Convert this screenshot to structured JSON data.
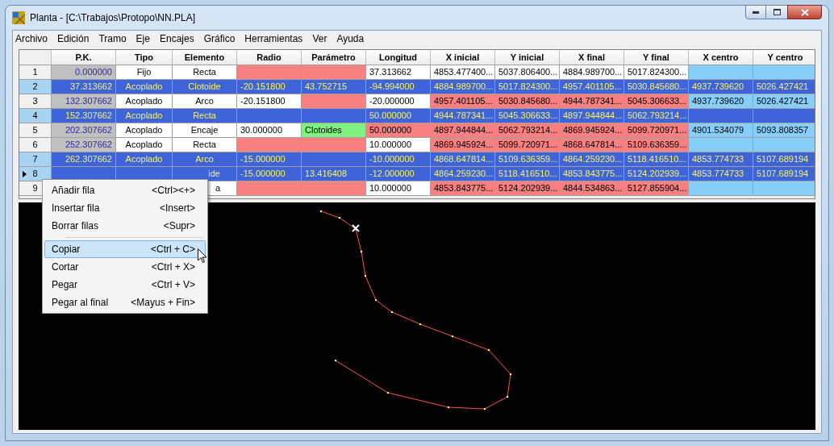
{
  "window": {
    "title": "Planta - [C:\\Trabajos\\Protopo\\NN.PLA]"
  },
  "menu_bar": [
    "Archivo",
    "Edición",
    "Tramo",
    "Eje",
    "Encajes",
    "Gráfico",
    "Herramientas",
    "Ver",
    "Ayuda"
  ],
  "table": {
    "columns": [
      "P.K.",
      "Tipo",
      "Elemento",
      "Radio",
      "Parámetro",
      "Longitud",
      "X inicial",
      "Y inicial",
      "X final",
      "Y final",
      "X centro",
      "Y centro"
    ],
    "rows": [
      {
        "number": "1",
        "selected": false,
        "current": false,
        "cells": [
          {
            "text": "0.000000",
            "color": "#c0c0c0"
          },
          {
            "text": "Fijo",
            "color": "#ffffff"
          },
          {
            "text": "Recta",
            "color": "#ffffff"
          },
          {
            "color": "#f88080"
          },
          {
            "color": "#f88080"
          },
          {
            "text": "37.313662",
            "color": "#ffffff"
          },
          {
            "text": "4853.477400...",
            "color": "#ffffff"
          },
          {
            "text": "5037.806400...",
            "color": "#ffffff"
          },
          {
            "text": "4884.989700...",
            "color": "#ffffff"
          },
          {
            "text": "5017.824300...",
            "color": "#ffffff"
          },
          {
            "color": "#87cefa"
          },
          {
            "color": "#87cefa"
          }
        ]
      },
      {
        "number": "2",
        "selected": true,
        "current": false,
        "cells": [
          {
            "text": "37.313662"
          },
          {
            "text": "Acoplado"
          },
          {
            "text": "Clotoide"
          },
          {
            "text": "-20.151800"
          },
          {
            "text": "43.752715"
          },
          {
            "text": "-94.994000"
          },
          {
            "text": "4884.989700..."
          },
          {
            "text": "5017.824300..."
          },
          {
            "text": "4957.401105..."
          },
          {
            "text": "5030.845680..."
          },
          {
            "text": "4937.739620"
          },
          {
            "text": "5026.427421"
          }
        ]
      },
      {
        "number": "3",
        "selected": false,
        "current": false,
        "cells": [
          {
            "text": "132.307662",
            "color": "#c0c0c0"
          },
          {
            "text": "Acoplado",
            "color": "#ffffff"
          },
          {
            "text": "Arco",
            "color": "#ffffff"
          },
          {
            "text": "-20.151800",
            "color": "#ffffff"
          },
          {
            "color": "#f88080"
          },
          {
            "text": "-20.000000",
            "color": "#ffffff"
          },
          {
            "text": "4957.401105...",
            "color": "#f88080"
          },
          {
            "text": "5030.845680...",
            "color": "#f88080"
          },
          {
            "text": "4944.787341...",
            "color": "#f88080"
          },
          {
            "text": "5045.306633...",
            "color": "#f88080"
          },
          {
            "text": "4937.739620",
            "color": "#87cefa"
          },
          {
            "text": "5026.427421",
            "color": "#87cefa"
          }
        ]
      },
      {
        "number": "4",
        "selected": true,
        "current": false,
        "cells": [
          {
            "text": "152.307662"
          },
          {
            "text": "Acoplado"
          },
          {
            "text": "Recta"
          },
          {},
          {},
          {
            "text": "50.000000"
          },
          {
            "text": "4944.787341..."
          },
          {
            "text": "5045.306633..."
          },
          {
            "text": "4897.944844..."
          },
          {
            "text": "5062.793214..."
          },
          {},
          {}
        ]
      },
      {
        "number": "5",
        "selected": false,
        "current": false,
        "cells": [
          {
            "text": "202.307662",
            "color": "#c0c0c0"
          },
          {
            "text": "Acoplado",
            "color": "#ffffff"
          },
          {
            "text": "Encaje",
            "color": "#ffffff"
          },
          {
            "text": "30.000000",
            "color": "#ffffff"
          },
          {
            "text": "Clotoides",
            "color": "#80f080"
          },
          {
            "text": "50.000000",
            "color": "#f88080"
          },
          {
            "text": "4897.944844...",
            "color": "#f88080"
          },
          {
            "text": "5062.793214...",
            "color": "#f88080"
          },
          {
            "text": "4869.945924...",
            "color": "#f88080"
          },
          {
            "text": "5099.720971...",
            "color": "#f88080"
          },
          {
            "text": "4901.534079",
            "color": "#87cefa"
          },
          {
            "text": "5093.808357",
            "color": "#87cefa"
          }
        ]
      },
      {
        "number": "6",
        "selected": false,
        "current": false,
        "cells": [
          {
            "text": "252.307662",
            "color": "#c0c0c0"
          },
          {
            "text": "Acoplado",
            "color": "#ffffff"
          },
          {
            "text": "Recta",
            "color": "#ffffff"
          },
          {
            "color": "#f88080"
          },
          {
            "color": "#f88080"
          },
          {
            "text": "10.000000",
            "color": "#ffffff"
          },
          {
            "text": "4869.945924...",
            "color": "#f88080"
          },
          {
            "text": "5099.720971...",
            "color": "#f88080"
          },
          {
            "text": "4868.647814...",
            "color": "#f88080"
          },
          {
            "text": "5109.636359...",
            "color": "#f88080"
          },
          {
            "color": "#87cefa"
          },
          {
            "color": "#87cefa"
          }
        ]
      },
      {
        "number": "7",
        "selected": true,
        "current": false,
        "cells": [
          {
            "text": "262.307662"
          },
          {
            "text": "Acoplado"
          },
          {
            "text": "Arco"
          },
          {
            "text": "-15.000000"
          },
          {},
          {
            "text": "-10.000000"
          },
          {
            "text": "4868.647814..."
          },
          {
            "text": "5109.636359..."
          },
          {
            "text": "4864.259230..."
          },
          {
            "text": "5118.416510..."
          },
          {
            "text": "4853.774733"
          },
          {
            "text": "5107.689194"
          }
        ]
      },
      {
        "number": "8",
        "selected": true,
        "current": true,
        "cells": [
          {},
          {},
          {
            "text": "ide",
            "partly_covered": true
          },
          {
            "text": "-15.000000"
          },
          {
            "text": "13.416408"
          },
          {
            "text": "-12.000000"
          },
          {
            "text": "4864.259230..."
          },
          {
            "text": "5118.416510..."
          },
          {
            "text": "4853.843775..."
          },
          {
            "text": "5124.202939..."
          },
          {
            "text": "4853.774733"
          },
          {
            "text": "5107.689194"
          }
        ]
      },
      {
        "number": "9",
        "selected": false,
        "current": false,
        "cells": [
          {},
          {},
          {
            "text": "a",
            "color": "#ffffff",
            "partly_covered": true
          },
          {
            "color": "#f88080"
          },
          {
            "color": "#f88080"
          },
          {
            "text": "10.000000",
            "color": "#ffffff"
          },
          {
            "text": "4853.843775...",
            "color": "#f88080"
          },
          {
            "text": "5124.202939...",
            "color": "#f88080"
          },
          {
            "text": "4844.534863...",
            "color": "#f88080"
          },
          {
            "text": "5127.855904...",
            "color": "#f88080"
          },
          {
            "color": "#87cefa"
          },
          {
            "color": "#87cefa"
          }
        ]
      }
    ]
  },
  "context_menu": [
    {
      "kind": "item",
      "label": "Añadir fila",
      "shortcut": "<Ctrl><+>",
      "selected": false
    },
    {
      "kind": "item",
      "label": "Insertar fila",
      "shortcut": "<Insert>",
      "selected": false
    },
    {
      "kind": "item",
      "label": "Borrar filas",
      "shortcut": "<Supr>",
      "selected": false
    },
    {
      "kind": "separator"
    },
    {
      "kind": "item",
      "label": "Copiar",
      "shortcut": "<Ctrl + C>",
      "selected": true
    },
    {
      "kind": "item",
      "label": "Cortar",
      "shortcut": "<Ctrl + X>",
      "selected": false
    },
    {
      "kind": "item",
      "label": "Pegar",
      "shortcut": "<Ctrl + V>",
      "selected": false
    },
    {
      "kind": "item",
      "label": "Pegar al final",
      "shortcut": "<Mayus + Fin>",
      "selected": false
    }
  ]
}
